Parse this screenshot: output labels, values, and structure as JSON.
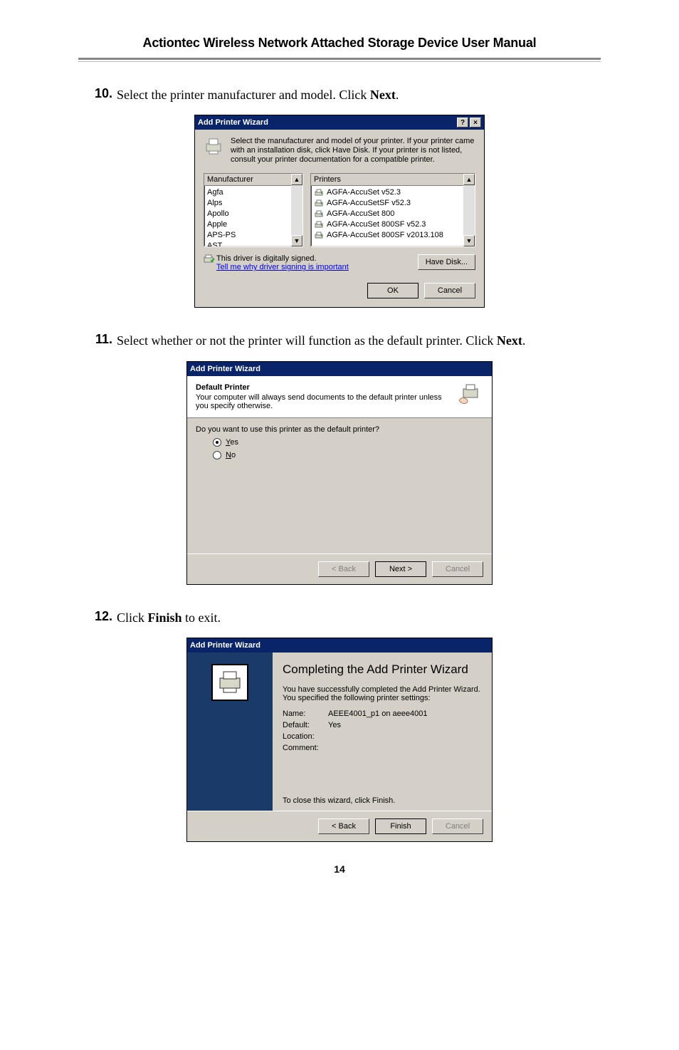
{
  "manual_title": "Actiontec Wireless Network Attached Storage Device User Manual",
  "page_number": "14",
  "steps": {
    "s10": {
      "num": "10.",
      "text_a": "Select the printer manufacturer and model. Click ",
      "bold": "Next",
      "text_b": "."
    },
    "s11": {
      "num": "11.",
      "text_a": "Select whether or not the printer will function as the default printer. Click ",
      "bold": "Next",
      "text_b": "."
    },
    "s12": {
      "num": "12.",
      "text_a": "Click ",
      "bold": "Finish",
      "text_b": " to exit."
    }
  },
  "dlg1": {
    "title": "Add Printer Wizard",
    "help_glyph": "?",
    "close_glyph": "×",
    "desc": "Select the manufacturer and model of your printer. If your printer came with an installation disk, click Have Disk. If your printer is not listed, consult your printer documentation for a compatible printer.",
    "manu_header": "Manufacturer",
    "manu_items": [
      "Agfa",
      "Alps",
      "Apollo",
      "Apple",
      "APS-PS",
      "AST"
    ],
    "printers_header": "Printers",
    "printer_items": [
      "AGFA-AccuSet v52.3",
      "AGFA-AccuSetSF v52.3",
      "AGFA-AccuSet 800",
      "AGFA-AccuSet 800SF v52.3",
      "AGFA-AccuSet 800SF v2013.108"
    ],
    "signed_text": "This driver is digitally signed.",
    "signed_link": "Tell me why driver signing is important",
    "have_disk": "Have Disk...",
    "ok": "OK",
    "cancel": "Cancel"
  },
  "dlg2": {
    "title": "Add Printer Wizard",
    "heading": "Default Printer",
    "sub": "Your computer will always send documents to the default printer unless you specify otherwise.",
    "question": "Do you want to use this printer as the default printer?",
    "yes_u": "Y",
    "yes_rest": "es",
    "no_u": "N",
    "no_rest": "o",
    "back": "< Back",
    "next": "Next >",
    "cancel": "Cancel"
  },
  "dlg3": {
    "title": "Add Printer Wizard",
    "heading": "Completing the Add Printer Wizard",
    "sub1": "You have successfully completed the Add Printer Wizard.",
    "sub2": "You specified the following printer settings:",
    "name_k": "Name:",
    "name_v": "AEEE4001_p1 on aeee4001",
    "def_k": "Default:",
    "def_v": "Yes",
    "loc_k": "Location:",
    "loc_v": "",
    "com_k": "Comment:",
    "com_v": "",
    "close_hint": "To close this wizard, click Finish.",
    "back": "< Back",
    "finish": "Finish",
    "cancel": "Cancel"
  }
}
